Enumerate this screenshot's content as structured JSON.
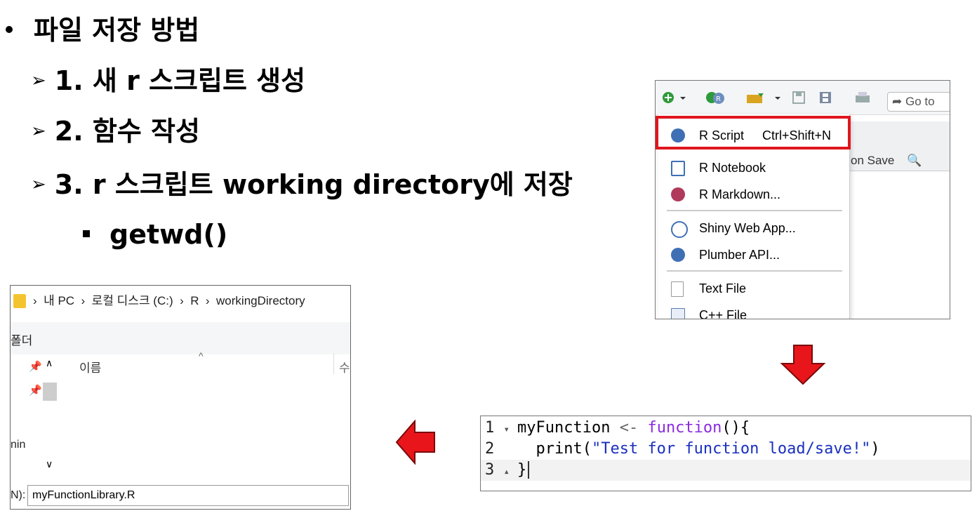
{
  "bullets": {
    "main": "파일 저장 방법",
    "steps": [
      "1. 새 r 스크립트 생성",
      "2. 함수 작성",
      "3. r 스크립트 working directory에 저장"
    ],
    "sub": "getwd()"
  },
  "rstudio": {
    "goto_label": "Go to",
    "save_text": "on Save",
    "menu": [
      {
        "label": "R Script",
        "shortcut": "Ctrl+Shift+N",
        "icon": "r-script-icon",
        "highlighted": true
      },
      {
        "label": "R Notebook",
        "icon": "r-notebook-icon"
      },
      {
        "label": "R Markdown...",
        "icon": "r-markdown-icon"
      },
      {
        "label": "Shiny Web App...",
        "icon": "shiny-icon"
      },
      {
        "label": "Plumber API...",
        "icon": "plumber-icon"
      },
      {
        "label": "Text File",
        "icon": "text-file-icon"
      },
      {
        "label": "C++ File",
        "icon": "cpp-file-icon"
      }
    ]
  },
  "editor": {
    "lines": [
      {
        "num": "1",
        "fold": "▾",
        "a": "myFunction ",
        "op": "<-",
        "kw": " function",
        "b": "(){"
      },
      {
        "num": "2",
        "fold": "",
        "a": "  print(",
        "str": "\"Test for function load/save!\"",
        "b": ")"
      },
      {
        "num": "3",
        "fold": "▴",
        "a": "}",
        "b": ""
      }
    ]
  },
  "explorer": {
    "path_items": [
      "내 PC",
      "로컬 디스크 (C:)",
      "R",
      "workingDirectory"
    ],
    "ribbon_text": "폴더",
    "column_name": "이름",
    "column_partial": "수",
    "sidebar_text": "nin",
    "filename_label": "N):",
    "filename_value": "myFunctionLibrary.R"
  },
  "colors": {
    "highlight_border": "#e0161e",
    "arrow": "#e8161b"
  }
}
